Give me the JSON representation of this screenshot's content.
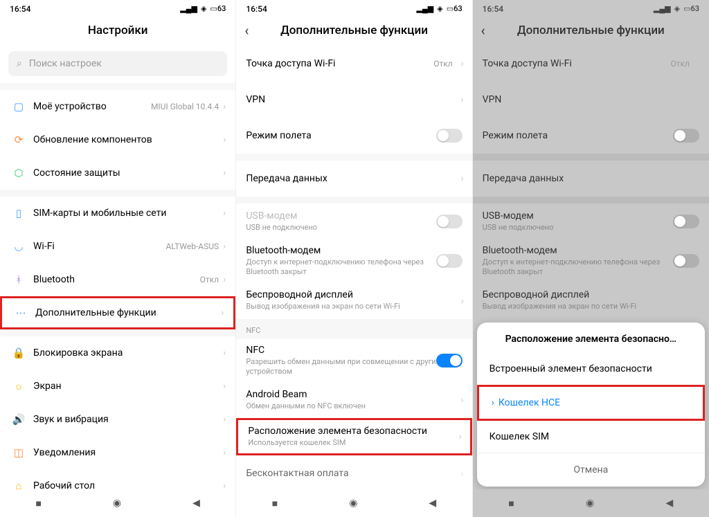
{
  "status": {
    "time": "16:54",
    "battery": "63"
  },
  "p1": {
    "title": "Настройки",
    "search_placeholder": "Поиск настроек",
    "items": [
      {
        "label": "Моё устройство",
        "value": "MIUI Global 10.4.4",
        "icon": "device",
        "color": "#4aa3ff"
      },
      {
        "label": "Обновление компонентов",
        "value": "",
        "icon": "update",
        "color": "#ff8c3b"
      },
      {
        "label": "Состояние защиты",
        "value": "",
        "icon": "shield",
        "color": "#2ecc71"
      }
    ],
    "items2": [
      {
        "label": "SIM-карты и мобильные сети",
        "value": "",
        "icon": "sim",
        "color": "#4aa3ff"
      },
      {
        "label": "Wi-Fi",
        "value": "ALTWeb-ASUS",
        "icon": "wifi",
        "color": "#4aa3ff"
      },
      {
        "label": "Bluetooth",
        "value": "Откл",
        "icon": "bt",
        "color": "#a56eff"
      },
      {
        "label": "Дополнительные функции",
        "value": "",
        "icon": "more",
        "color": "#4aa3ff",
        "highlight": true
      }
    ],
    "items3": [
      {
        "label": "Блокировка экрана",
        "value": "",
        "icon": "lock",
        "color": "#ff6b6b"
      },
      {
        "label": "Экран",
        "value": "",
        "icon": "display",
        "color": "#ffb400"
      },
      {
        "label": "Звук и вибрация",
        "value": "",
        "icon": "sound",
        "color": "#4aa3ff"
      },
      {
        "label": "Уведомления",
        "value": "",
        "icon": "notif",
        "color": "#ff8c3b"
      },
      {
        "label": "Рабочий стол",
        "value": "",
        "icon": "home",
        "color": "#ffb400"
      }
    ]
  },
  "p2": {
    "title": "Дополнительные функции",
    "g1": [
      {
        "label": "Точка доступа Wi-Fi",
        "value": "Откл"
      },
      {
        "label": "VPN",
        "value": ""
      },
      {
        "label": "Режим полета",
        "toggle": false
      }
    ],
    "g2": [
      {
        "label": "Передача данных"
      }
    ],
    "g3": [
      {
        "label": "USB-модем",
        "sub": "USB не подключено",
        "toggle": false,
        "disabled": true
      },
      {
        "label": "Bluetooth-модем",
        "sub": "Доступ к интернет-подключению телефона через Bluetooth закрыт",
        "toggle": false
      },
      {
        "label": "Беспроводной дисплей",
        "sub": "Вывод изображения на экран по сети Wi-Fi"
      }
    ],
    "nfc_section": "NFC",
    "g4": [
      {
        "label": "NFC",
        "sub": "Разрешить обмен данными при совмещении с другим устройством",
        "toggle": true
      },
      {
        "label": "Android Beam",
        "sub": "Обмен данными по NFC включен"
      },
      {
        "label": "Расположение элемента безопасности",
        "sub": "Используется кошелек SIM",
        "highlight": true
      },
      {
        "label": "Бесконтактная оплата",
        "sub": ""
      }
    ]
  },
  "p3": {
    "title": "Дополнительные функции",
    "dialog": {
      "title": "Расположение элемента безопасно…",
      "options": [
        "Встроенный элемент безопасности",
        "Кошелек HCE",
        "Кошелек SIM"
      ],
      "selected_index": 1,
      "cancel": "Отмена"
    }
  }
}
